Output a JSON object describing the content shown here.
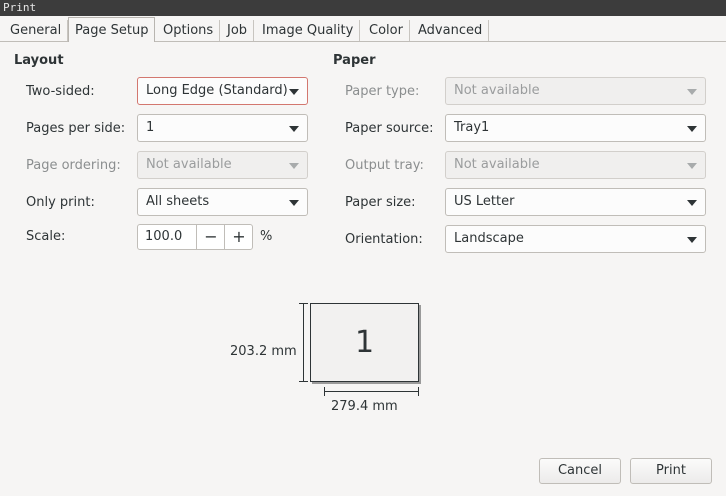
{
  "window": {
    "title": "Print"
  },
  "tabs": [
    {
      "label": "General"
    },
    {
      "label": "Page Setup",
      "active": true
    },
    {
      "label": "Options"
    },
    {
      "label": "Job"
    },
    {
      "label": "Image Quality"
    },
    {
      "label": "Color"
    },
    {
      "label": "Advanced"
    }
  ],
  "layout": {
    "title": "Layout",
    "two_sided": {
      "label": "Two-sided:",
      "value": "Long Edge (Standard)"
    },
    "pages_per_side": {
      "label": "Pages per side:",
      "value": "1"
    },
    "page_ordering": {
      "label": "Page ordering:",
      "value": "Not available"
    },
    "only_print": {
      "label": "Only print:",
      "value": "All sheets"
    },
    "scale": {
      "label": "Scale:",
      "value": "100.0",
      "minus": "−",
      "plus": "+",
      "unit": "%"
    }
  },
  "paper": {
    "title": "Paper",
    "paper_type": {
      "label": "Paper type:",
      "value": "Not available"
    },
    "paper_source": {
      "label": "Paper source:",
      "value": "Tray1"
    },
    "output_tray": {
      "label": "Output tray:",
      "value": "Not available"
    },
    "paper_size": {
      "label": "Paper size:",
      "value": "US Letter"
    },
    "orientation": {
      "label": "Orientation:",
      "value": "Landscape"
    }
  },
  "preview": {
    "page_number": "1",
    "height_label": "203.2 mm",
    "width_label": "279.4 mm"
  },
  "buttons": {
    "cancel": "Cancel",
    "print": "Print"
  },
  "colors": {
    "focus_border": "#d3776f",
    "window_bg": "#f6f5f4",
    "titlebar_bg": "#3c3c3c"
  }
}
